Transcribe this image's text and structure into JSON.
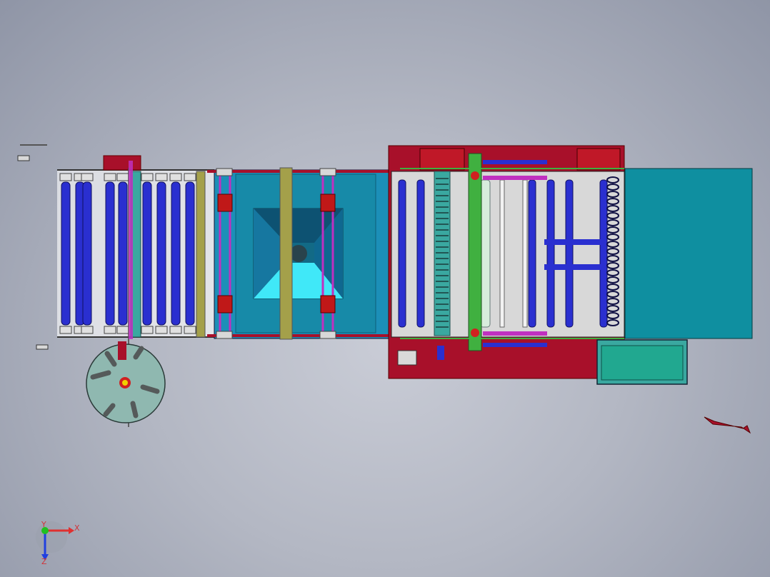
{
  "viewport": {
    "background_top": "#8f95a6",
    "background_center": "#c9ccd6"
  },
  "triad": {
    "x_label": "X",
    "y_label": "Y",
    "z_label": "Z",
    "x_color": "#e03030",
    "y_color": "#20c020",
    "z_color": "#2040e0"
  },
  "colors": {
    "frame_red": "#a8102a",
    "roller_blue": "#2a2fd0",
    "teal_panel": "#0f8fa0",
    "bed_blue": "#1c8fb8",
    "hopper_cyan": "#40e8f8",
    "olive_rail": "#a4a04a",
    "magenta_rod": "#c030c0",
    "green_rod": "#40b040",
    "reel_gray": "#8fb8b0"
  }
}
